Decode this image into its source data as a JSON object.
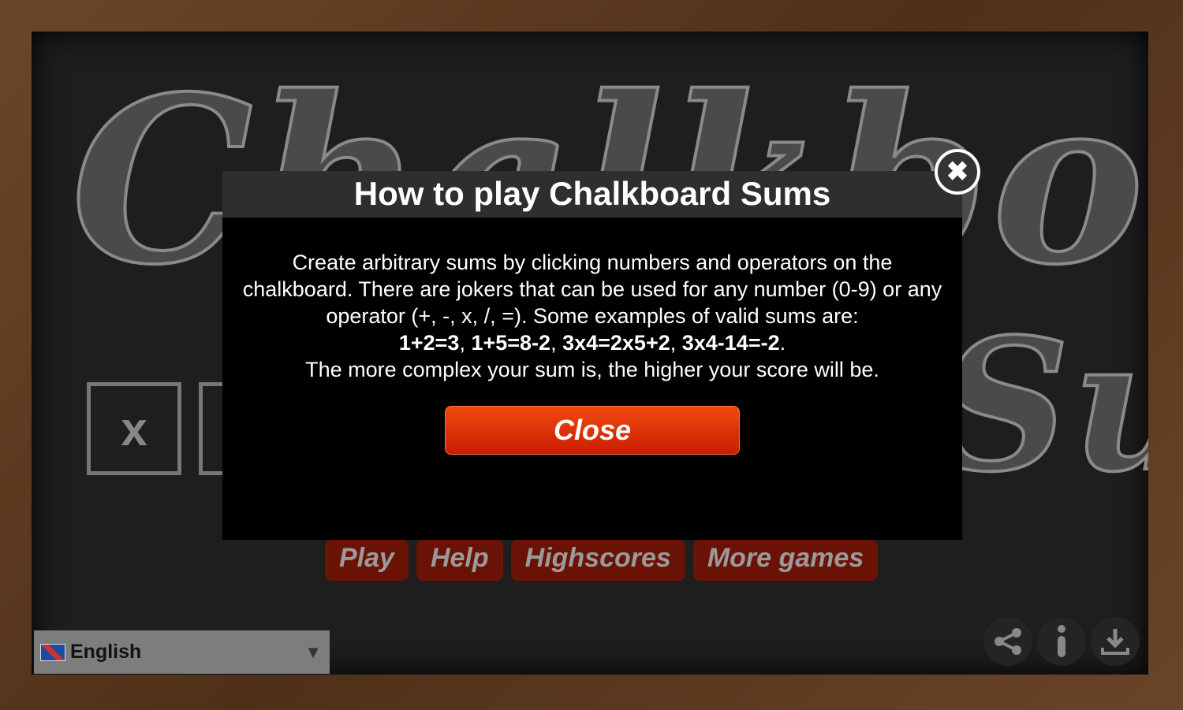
{
  "background": {
    "title_line1": "Chalkboard",
    "title_line2": "Sums",
    "tile_symbol": "x"
  },
  "menu": [
    "Play",
    "Help",
    "Highscores",
    "More games"
  ],
  "language": {
    "selected": "English",
    "flag": "uk-flag-icon"
  },
  "icons": [
    "share-icon",
    "info-icon",
    "download-icon"
  ],
  "modal": {
    "title": "How to play Chalkboard Sums",
    "line1": "Create arbitrary sums by clicking numbers and operators on the chalkboard. There are jokers that can be used for any number (0-9) or any operator (+, -, x, /, =). Some examples of valid sums are:",
    "examples": [
      "1+2=3",
      "1+5=8-2",
      "3x4=2x5+2",
      "3x4-14=-2"
    ],
    "line3": "The more complex your sum is, the higher your score will be.",
    "close_label": "Close"
  },
  "colors": {
    "accent": "#e03a08",
    "board": "#1e1e1e",
    "frame": "#5a3a22"
  }
}
